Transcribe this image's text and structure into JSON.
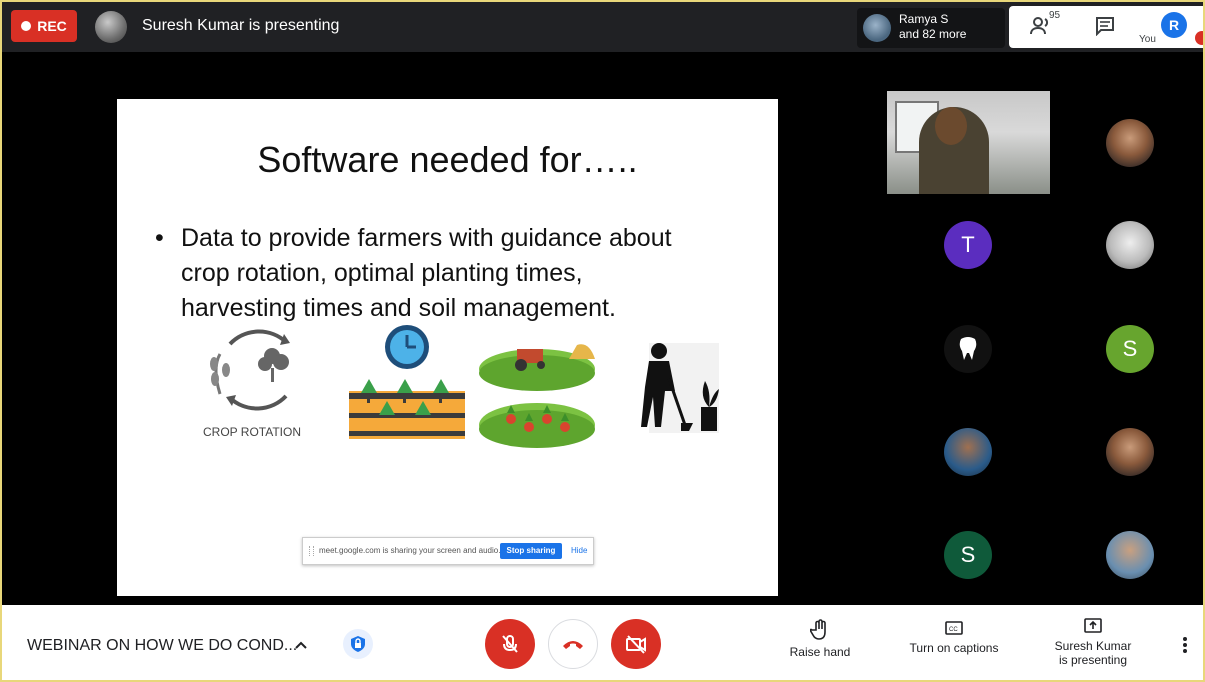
{
  "top_bar": {
    "rec_label": "REC",
    "presenting_text": "Suresh Kumar is presenting",
    "speaker_name": "Ramya S",
    "speaker_more": "and 82 more",
    "people_count": "95",
    "you_initial": "R",
    "you_label": "You"
  },
  "slide": {
    "title": "Software needed for…..",
    "bullet": "•",
    "lines": [
      "Data to provide farmers with guidance about",
      "crop rotation, optimal planting times,",
      "harvesting times and soil management."
    ],
    "crop_rotation_label": "CROP ROTATION",
    "share_bar": {
      "message": "meet.google.com is sharing your screen and audio.",
      "stop_label": "Stop sharing",
      "hide_label": "Hide"
    }
  },
  "participants": [
    {
      "initial": "T",
      "color": "#5b2dbf"
    },
    {
      "initial": "S",
      "color": "#67a52e"
    },
    {
      "initial": "S",
      "color": "#0f5a3a"
    }
  ],
  "bottom_bar": {
    "meeting_title": "WEBINAR ON HOW WE DO COND...",
    "raise_hand": "Raise hand",
    "captions": "Turn on captions",
    "presenting_line1": "Suresh Kumar",
    "presenting_line2": "is presenting"
  },
  "colors": {
    "accent_red": "#d93025",
    "accent_blue": "#1a73e8",
    "bar_dark": "#202124"
  }
}
